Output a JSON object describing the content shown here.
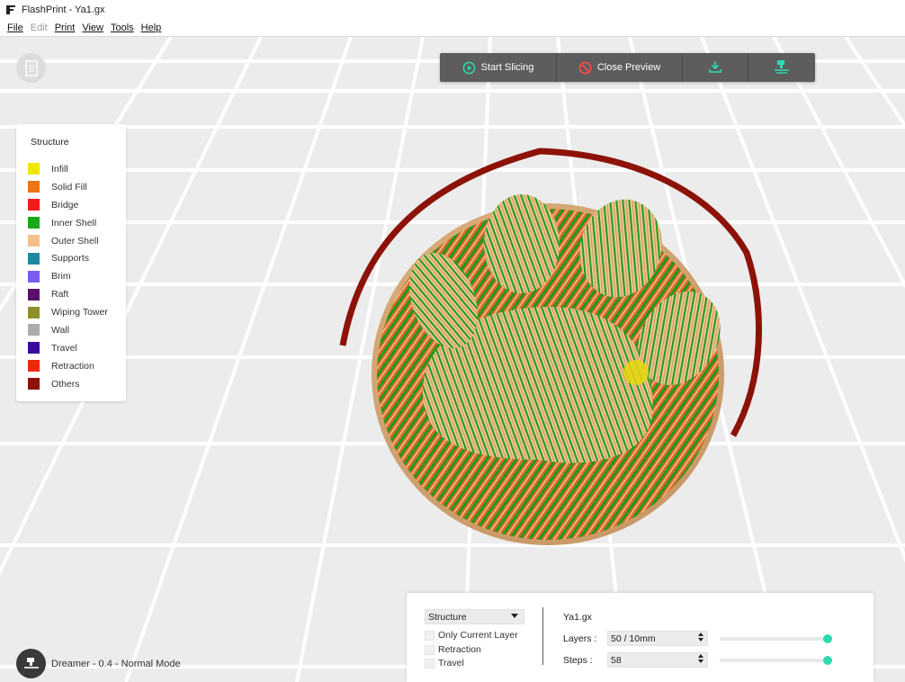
{
  "window": {
    "title": "FlashPrint - Ya1.gx"
  },
  "menubar": {
    "items": [
      {
        "label": "File",
        "enabled": true
      },
      {
        "label": "Edit",
        "enabled": false
      },
      {
        "label": "Print",
        "enabled": true
      },
      {
        "label": "View",
        "enabled": true
      },
      {
        "label": "Tools",
        "enabled": true
      },
      {
        "label": "Help",
        "enabled": true
      }
    ]
  },
  "toolbar": {
    "start_slicing": "Start Slicing",
    "close_preview": "Close Preview",
    "export_icon": "download-icon",
    "printer_icon": "printer-connect-icon",
    "accent_color": "#2edbb0",
    "stop_color": "#ff4a4a"
  },
  "legend": {
    "title": "Structure",
    "items": [
      {
        "label": "Infill",
        "color": "#f2e600"
      },
      {
        "label": "Solid Fill",
        "color": "#ec7414"
      },
      {
        "label": "Bridge",
        "color": "#f51b1b"
      },
      {
        "label": "Inner Shell",
        "color": "#18a818"
      },
      {
        "label": "Outer Shell",
        "color": "#f4c089"
      },
      {
        "label": "Supports",
        "color": "#1d8aa0"
      },
      {
        "label": "Brim",
        "color": "#7b5cf0"
      },
      {
        "label": "Raft",
        "color": "#5a0f6e"
      },
      {
        "label": "Wiping Tower",
        "color": "#8f8f2a"
      },
      {
        "label": "Wall",
        "color": "#ababab"
      },
      {
        "label": "Travel",
        "color": "#3b0aa0"
      },
      {
        "label": "Retraction",
        "color": "#f0280a"
      },
      {
        "label": "Others",
        "color": "#8c1208"
      }
    ]
  },
  "printer": {
    "status": "Dreamer - 0.4 - Normal Mode"
  },
  "preview_panel": {
    "view_mode": "Structure",
    "only_current_layer": "Only Current Layer",
    "retraction": "Retraction",
    "travel": "Travel",
    "file_name": "Ya1.gx",
    "layers_label": "Layers :",
    "layers_value": "50 / 10mm",
    "steps_label": "Steps :",
    "steps_value": "58",
    "layers_slider_fraction": 1.0,
    "steps_slider_fraction": 1.0
  }
}
